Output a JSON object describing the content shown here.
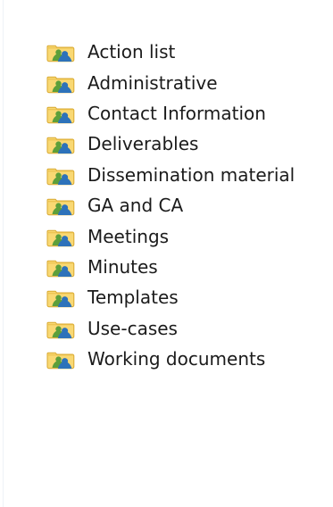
{
  "folders": [
    {
      "label": "Action list",
      "icon": "shared-folder-icon"
    },
    {
      "label": "Administrative",
      "icon": "shared-folder-icon"
    },
    {
      "label": "Contact Information",
      "icon": "shared-folder-icon"
    },
    {
      "label": "Deliverables",
      "icon": "shared-folder-icon"
    },
    {
      "label": "Dissemination material",
      "icon": "shared-folder-icon"
    },
    {
      "label": "GA and CA",
      "icon": "shared-folder-icon"
    },
    {
      "label": "Meetings",
      "icon": "shared-folder-icon"
    },
    {
      "label": "Minutes",
      "icon": "shared-folder-icon"
    },
    {
      "label": "Templates",
      "icon": "shared-folder-icon"
    },
    {
      "label": "Use-cases",
      "icon": "shared-folder-icon"
    },
    {
      "label": "Working documents",
      "icon": "shared-folder-icon"
    }
  ],
  "colors": {
    "folder_light": "#f9d873",
    "folder_dark": "#d8a82f",
    "user_green": "#5d9f3a",
    "user_blue": "#2d72ba",
    "text": "#1b1b1b"
  }
}
